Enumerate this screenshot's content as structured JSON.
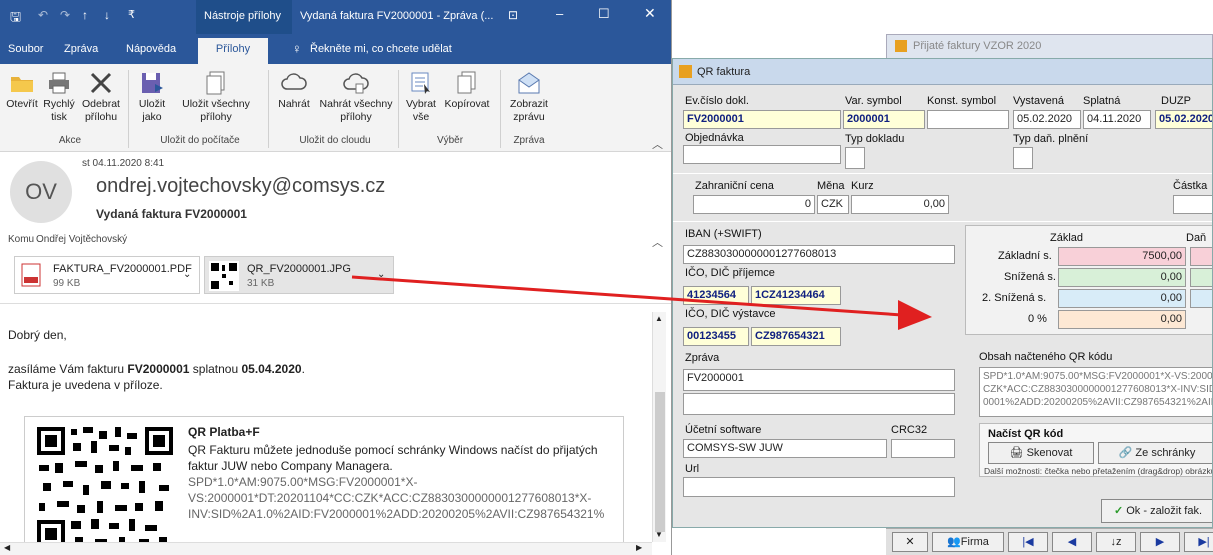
{
  "outlook": {
    "title_tools": "Nástroje přílohy",
    "title": "Vydaná faktura FV2000001 - Zpráva (...",
    "tabs": [
      "Soubor",
      "Zpráva",
      "Nápověda",
      "Přílohy"
    ],
    "tell_me": "Řekněte mi, co chcete udělat",
    "ribbon": {
      "buttons": [
        {
          "label": "Otevřít"
        },
        {
          "label": "Rychlý tisk"
        },
        {
          "label": "Odebrat přílohu"
        },
        {
          "label": "Uložit jako"
        },
        {
          "label": "Uložit všechny přílohy"
        },
        {
          "label": "Nahrát"
        },
        {
          "label": "Nahrát všechny přílohy"
        },
        {
          "label": "Vybrat vše"
        },
        {
          "label": "Kopírovat"
        },
        {
          "label": "Zobrazit zprávu"
        }
      ],
      "groups": [
        "Akce",
        "Uložit do počítače",
        "Uložit do cloudu",
        "Výběr",
        "Zpráva"
      ]
    },
    "header": {
      "date": "st 04.11.2020 8:41",
      "avatar": "OV",
      "sender": "ondrej.vojtechovsky@comsys.cz",
      "subject": "Vydaná faktura FV2000001",
      "to_label": "Komu",
      "to": "Ondřej Vojtěchovský"
    },
    "attachments": [
      {
        "name": "FAKTURA_FV2000001.PDF",
        "size": "99 KB"
      },
      {
        "name": "QR_FV2000001.JPG",
        "size": "31 KB"
      }
    ],
    "body": {
      "greeting": "Dobrý den,",
      "line1_a": "zasíláme Vám fakturu ",
      "line1_b": "FV2000001",
      "line1_c": " splatnou ",
      "line1_d": "05.04.2020",
      "line1_e": ".",
      "line2": "Faktura je uvedena v příloze.",
      "qr_title": "QR Platba+F",
      "qr_text1": "QR Fakturu můžete jednoduše pomocí schránky Windows načíst do přijatých",
      "qr_text2": "faktur JUW nebo Company Managera.",
      "qr_code1": "SPD*1.0*AM:9075.00*MSG:FV2000001*X-",
      "qr_code2": "VS:2000001*DT:20201104*CC:CZK*ACC:CZ8830300000001277608013*X-",
      "qr_code3": "INV:SID%2A1.0%2AID:FV2000001%2ADD:20200205%2AVII:CZ987654321%"
    }
  },
  "juw": {
    "bg_window_title": "Přijaté faktury VZOR 2020",
    "dialog_title": "QR faktura",
    "labels": {
      "evcislo": "Ev.číslo dokl.",
      "varsym": "Var. symbol",
      "konstsym": "Konst. symbol",
      "vystavena": "Vystavená",
      "splatna": "Splatná",
      "duzp": "DUZP",
      "objednavka": "Objednávka",
      "typdokladu": "Typ dokladu",
      "typdan": "Typ daň. plnění",
      "zahrcena": "Zahraniční cena",
      "mena": "Měna",
      "kurz": "Kurz",
      "castka": "Částka",
      "iban": "IBAN (+SWIFT)",
      "ico_prijemce": "IČO, DIČ příjemce",
      "ico_vystavce": "IČO, DIČ výstavce",
      "zprava": "Zpráva",
      "ucetni_sw": "Účetní software",
      "crc": "CRC32",
      "url": "Url",
      "zaklad": "Základ",
      "dan": "Daň",
      "zakladni": "Základní s.",
      "snizena": "Snížená s.",
      "snizena2": "2. Snížená s.",
      "nula": "0 %",
      "obsah": "Obsah načteného QR kódu",
      "nacist": "Načíst QR kód",
      "dalsi": "Další možnosti: čtečka nebo přetažením (drag&drop) obrázku"
    },
    "values": {
      "evcislo": "FV2000001",
      "varsym": "2000001",
      "vystavena": "05.02.2020",
      "splatna": "04.11.2020",
      "duzp": "05.02.2020",
      "zahrcena": "0",
      "mena": "CZK",
      "kurz": "0,00",
      "iban": "CZ8830300000001277608013",
      "ico_prijemce": "41234564",
      "dic_prijemce": "1CZ41234464",
      "ico_vystavce": "00123455",
      "dic_vystavce": "CZ987654321",
      "zprava": "FV2000001",
      "ucetni_sw": "COMSYS-SW JUW",
      "zakladni": "7500,00",
      "snizena": "0,00",
      "snizena2": "0,00",
      "nula": "0,00",
      "qr1": "SPD*1.0*AM:9075.00*MSG:FV2000001*X-VS:20000",
      "qr2": "CZK*ACC:CZ8830300000001277608013*X-INV:SID%",
      "qr3": "0001%2ADD:20200205%2AVII:CZ987654321%2AIN"
    },
    "buttons": {
      "skenovat": "Skenovat",
      "ze_schranky": "Ze schránky",
      "ok": "Ok - založit fak.",
      "firma": "Firma"
    }
  }
}
